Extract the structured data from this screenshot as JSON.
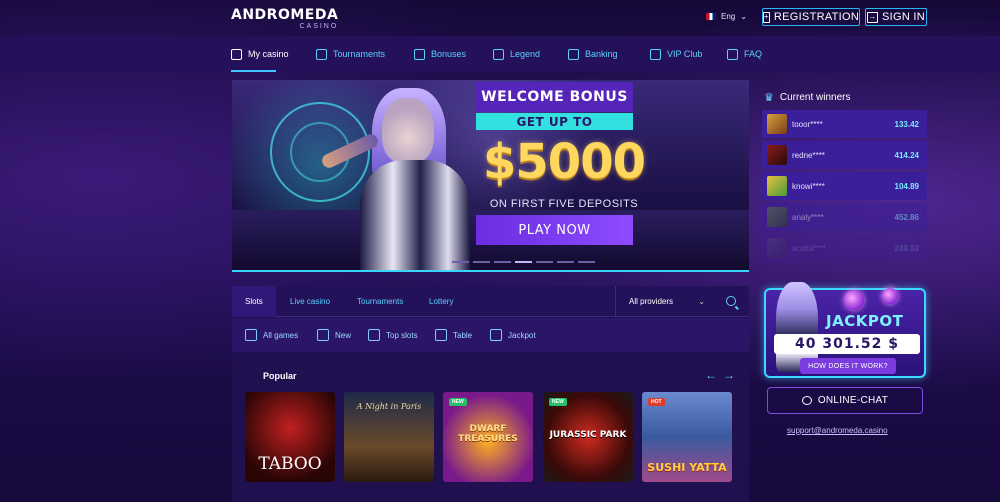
{
  "header": {
    "logo_main": "ANDROMEDA",
    "logo_sub": "CASINO",
    "language": "Eng",
    "registration_label": "REGISTRATION",
    "signin_label": "SIGN IN"
  },
  "nav": {
    "items": [
      {
        "label": "My casino",
        "icon": "casino-icon"
      },
      {
        "label": "Tournaments",
        "icon": "tournaments-icon"
      },
      {
        "label": "Bonuses",
        "icon": "bonuses-icon"
      },
      {
        "label": "Legend",
        "icon": "legend-icon"
      },
      {
        "label": "Banking",
        "icon": "banking-icon"
      },
      {
        "label": "VIP Club",
        "icon": "vip-icon"
      },
      {
        "label": "FAQ",
        "icon": "faq-icon"
      }
    ],
    "active": "My casino"
  },
  "banner": {
    "title": "WELCOME BONUS",
    "subtitle": "GET UP TO",
    "amount": "$5000",
    "description": "ON FIRST FIVE DEPOSITS",
    "cta": "PLAY NOW",
    "slide_count": 7,
    "active_slide": 3
  },
  "winners": {
    "title": "Current winners",
    "rows": [
      {
        "user": "tooor****",
        "amount": "133.42"
      },
      {
        "user": "redne****",
        "amount": "414.24"
      },
      {
        "user": "knowi****",
        "amount": "104.89"
      },
      {
        "user": "analy****",
        "amount": "452.86"
      },
      {
        "user": "scotta****",
        "amount": "249.53"
      }
    ]
  },
  "jackpot": {
    "label": "JACKPOT",
    "amount": "40 301.52 $",
    "how_label": "HOW DOES IT WORK?"
  },
  "chat": {
    "label": "ONLINE-CHAT",
    "support_email": "support@andromeda.casino"
  },
  "games_panel": {
    "tabs": [
      "Slots",
      "Live casino",
      "Tournaments",
      "Lottery"
    ],
    "active_tab": "Slots",
    "provider_select": "All providers",
    "subcategories": [
      "All games",
      "New",
      "Top slots",
      "Table",
      "Jackpot"
    ],
    "section_title": "Popular",
    "games": [
      {
        "title": "TABOO",
        "badge": ""
      },
      {
        "title": "A Night in Paris",
        "badge": ""
      },
      {
        "title": "DWARF TREASURES",
        "badge": "NEW"
      },
      {
        "title": "JURASSIC PARK",
        "badge": "NEW"
      },
      {
        "title": "SUSHI YATTA",
        "badge": "HOT"
      }
    ]
  },
  "colors": {
    "accent": "#3fc6ff",
    "nav_bg": "#25105a",
    "winner_row": "#3b1e99",
    "gold": "#ffd75e"
  }
}
